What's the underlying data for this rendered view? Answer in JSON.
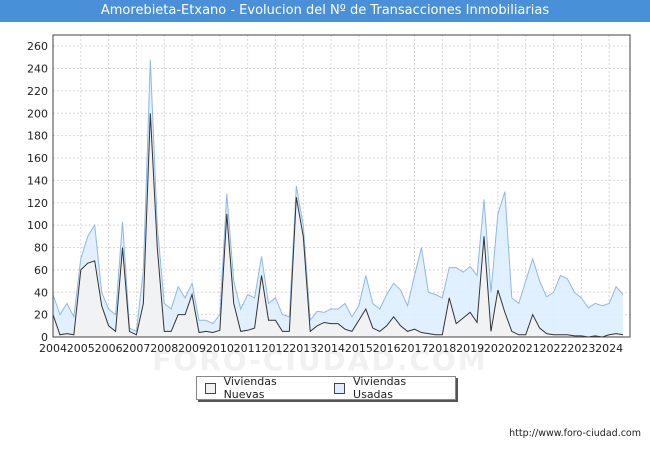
{
  "title": "Amorebieta-Etxano - Evolucion del Nº de Transacciones Inmobiliarias",
  "source": "http://www.foro-ciudad.com",
  "watermark": "FORO-CIUDAD.COM",
  "colors": {
    "title_bg": "#4a90d9",
    "nuevas_fill": "#f2f2f2",
    "nuevas_line": "#333333",
    "usadas_fill": "#ddeeff",
    "usadas_line": "#8fb8e8",
    "grid": "#d8d8d8"
  },
  "chart_data": {
    "type": "area",
    "ylim": [
      0,
      270
    ],
    "yticks": [
      0,
      20,
      40,
      60,
      80,
      100,
      120,
      140,
      160,
      180,
      200,
      220,
      240,
      260
    ],
    "xlim": [
      2004,
      2024.75
    ],
    "xticks": [
      "2004",
      "2005",
      "2006",
      "2007",
      "2008",
      "2009",
      "2010",
      "2011",
      "2012",
      "2013",
      "2014",
      "2015",
      "2016",
      "2017",
      "2018",
      "2019",
      "2020",
      "2021",
      "2022",
      "2023",
      "2024"
    ],
    "grid": true,
    "legend_position": "bottom",
    "x_quarters": [
      "2004T1",
      "2004T2",
      "2004T3",
      "2004T4",
      "2005T1",
      "2005T2",
      "2005T3",
      "2005T4",
      "2006T1",
      "2006T2",
      "2006T3",
      "2006T4",
      "2007T1",
      "2007T2",
      "2007T3",
      "2007T4",
      "2008T1",
      "2008T2",
      "2008T3",
      "2008T4",
      "2009T1",
      "2009T2",
      "2009T3",
      "2009T4",
      "2010T1",
      "2010T2",
      "2010T3",
      "2010T4",
      "2011T1",
      "2011T2",
      "2011T3",
      "2011T4",
      "2012T1",
      "2012T2",
      "2012T3",
      "2012T4",
      "2013T1",
      "2013T2",
      "2013T3",
      "2013T4",
      "2014T1",
      "2014T2",
      "2014T3",
      "2014T4",
      "2015T1",
      "2015T2",
      "2015T3",
      "2015T4",
      "2016T1",
      "2016T2",
      "2016T3",
      "2016T4",
      "2017T1",
      "2017T2",
      "2017T3",
      "2017T4",
      "2018T1",
      "2018T2",
      "2018T3",
      "2018T4",
      "2019T1",
      "2019T2",
      "2019T3",
      "2019T4",
      "2020T1",
      "2020T2",
      "2020T3",
      "2020T4",
      "2021T1",
      "2021T2",
      "2021T3",
      "2021T4",
      "2022T1",
      "2022T2",
      "2022T3",
      "2022T4",
      "2023T1",
      "2023T2",
      "2023T3",
      "2023T4",
      "2024T1",
      "2024T2",
      "2024T3"
    ],
    "series": [
      {
        "name": "Viviendas Nuevas",
        "values": [
          20,
          2,
          3,
          2,
          60,
          66,
          68,
          28,
          10,
          5,
          80,
          5,
          2,
          30,
          200,
          80,
          5,
          5,
          20,
          20,
          38,
          4,
          5,
          4,
          6,
          110,
          30,
          5,
          6,
          8,
          55,
          15,
          15,
          5,
          5,
          125,
          90,
          5,
          10,
          13,
          12,
          12,
          7,
          5,
          15,
          25,
          8,
          5,
          10,
          18,
          10,
          5,
          7,
          4,
          3,
          2,
          2,
          35,
          12,
          17,
          22,
          13,
          90,
          5,
          42,
          22,
          5,
          2,
          2,
          20,
          8,
          3,
          2,
          2,
          2,
          1,
          1,
          0,
          1,
          0,
          2,
          3,
          2
        ]
      },
      {
        "name": "Viviendas Usadas",
        "values": [
          38,
          20,
          30,
          18,
          70,
          90,
          100,
          40,
          25,
          20,
          103,
          8,
          5,
          60,
          248,
          100,
          30,
          25,
          45,
          35,
          48,
          15,
          15,
          12,
          20,
          128,
          50,
          25,
          38,
          35,
          72,
          30,
          35,
          20,
          18,
          135,
          100,
          15,
          23,
          22,
          25,
          25,
          30,
          18,
          28,
          55,
          30,
          25,
          38,
          48,
          42,
          28,
          55,
          80,
          40,
          38,
          35,
          62,
          62,
          58,
          63,
          55,
          123,
          40,
          110,
          130,
          35,
          30,
          50,
          70,
          50,
          36,
          40,
          55,
          52,
          40,
          35,
          26,
          30,
          28,
          30,
          45,
          38
        ]
      }
    ]
  }
}
